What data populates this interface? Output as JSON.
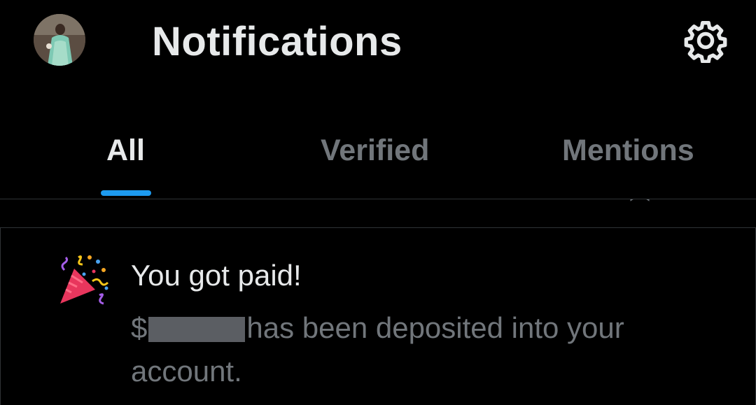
{
  "header": {
    "title": "Notifications",
    "avatar_icon": "profile-avatar",
    "settings_icon": "gear-icon"
  },
  "tabs": [
    {
      "label": "All",
      "active": true
    },
    {
      "label": "Verified",
      "active": false
    },
    {
      "label": "Mentions",
      "active": false
    }
  ],
  "colors": {
    "background": "#000000",
    "text_primary": "#e7e9ea",
    "text_secondary": "#71767b",
    "accent": "#1d9bf0",
    "divider": "#2f3336"
  },
  "notification": {
    "icon": "party-popper-icon",
    "title": "You got paid!",
    "body_prefix": "$",
    "body_suffix": "has been deposited into your account."
  }
}
